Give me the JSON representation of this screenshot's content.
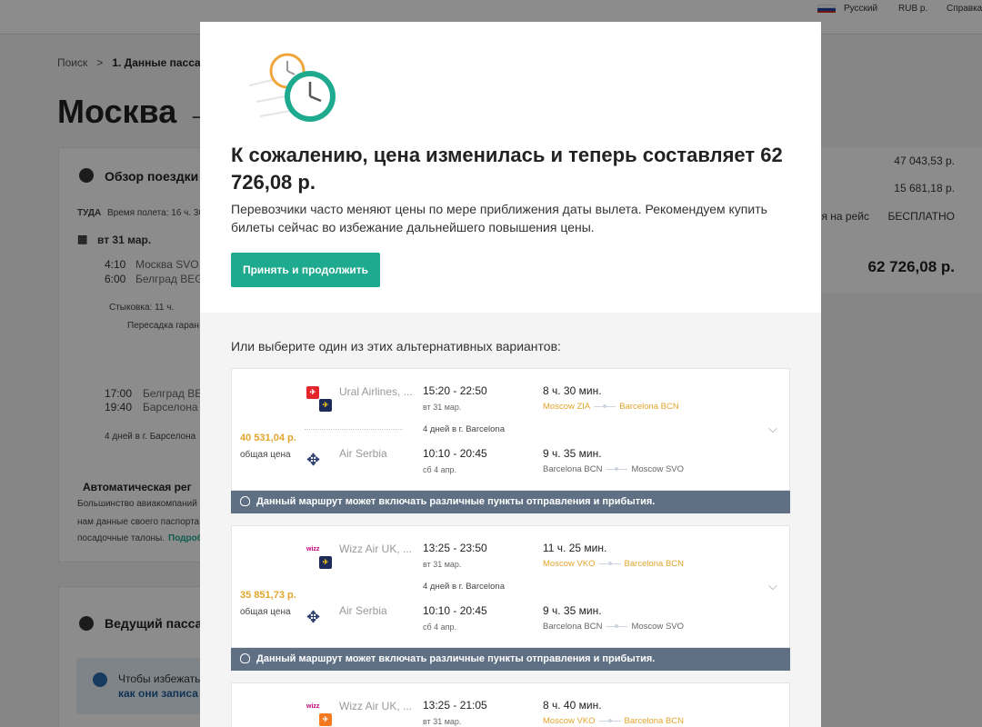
{
  "topbar": {
    "language": "Русский",
    "currency": "RUB р.",
    "help": "Справка",
    "flag_colors": [
      "#ffffff",
      "#1c48a8",
      "#d52b1e"
    ]
  },
  "background": {
    "breadcrumb": {
      "search": "Поиск",
      "separator": ">",
      "step": "1. Данные пасса"
    },
    "title": "Москва →",
    "trip": {
      "heading": "Обзор поездки",
      "direction": "ТУДА",
      "flight_time": "Время полета: 16 ч. 30",
      "date": "вт 31 мар.",
      "seg1_dep_time": "4:10",
      "seg1_dep": "Москва SVO",
      "seg1_arr_time": "6:00",
      "seg1_arr": "Белград BEG",
      "layover": "Стыковка: 11 ч.",
      "transfer": "Пересадка гаран",
      "seg2_dep_time": "17:00",
      "seg2_dep": "Белград BEG",
      "seg2_arr_time": "19:40",
      "seg2_arr": "Барселона B",
      "stay": "4 дней в г. Барселона"
    },
    "auto_reg": {
      "heading": "Автоматическая рег",
      "line1": "Большинство авиакомпаний",
      "line2": "нам данные своего паспорта",
      "line3": "посадочные талоны.",
      "link": "Подроб"
    },
    "passenger": {
      "heading": "Ведущий пассаж",
      "info1": "Чтобы избежать",
      "info2": "как они записа"
    },
    "prices": {
      "p1": "47 043,53 р.",
      "p2": "15 681,18 р.",
      "checkin_label": "я на рейс",
      "checkin_value": "БЕСПЛАТНО",
      "total": "62 726,08 р."
    }
  },
  "modal": {
    "heading": "К сожалению, цена изменилась и теперь составляет 62 726,08 р.",
    "text": "Перевозчики часто меняют цены по мере приближения даты вылета. Рекомендуем купить билеты сейчас во избежание дальнейшего повышения цены.",
    "accept_button": "Принять и продолжить",
    "alternatives_heading": "Или выберите один из этих альтернативных вариантов:",
    "accent_color": "#1eaa8e",
    "price_color": "#e3a52c",
    "banner_text": "Данный маршрут может включать различные пункты отправления и прибытия.",
    "options": [
      {
        "price": "40 531,04 р.",
        "price_label": "общая цена",
        "out_airline": "Ural Airlines, ...",
        "out_time": "15:20 - 22:50",
        "out_date": "вт 31 мар.",
        "out_duration": "8 ч. 30 мин.",
        "out_from": "Moscow ZIA",
        "out_to": "Barcelona BCN",
        "stay": "4 дней в г. Barcelona",
        "ret_airline": "Air Serbia",
        "ret_time": "10:10 - 20:45",
        "ret_date": "сб 4 апр.",
        "ret_duration": "9 ч. 35 мин.",
        "ret_from": "Barcelona BCN",
        "ret_to": "Moscow SVO"
      },
      {
        "price": "35 851,73 р.",
        "price_label": "общая цена",
        "out_airline": "Wizz Air UK, ...",
        "out_time": "13:25 - 23:50",
        "out_date": "вт 31 мар.",
        "out_duration": "11 ч. 25 мин.",
        "out_from": "Moscow VKO",
        "out_to": "Barcelona BCN",
        "stay": "4 дней в г. Barcelona",
        "ret_airline": "Air Serbia",
        "ret_time": "10:10 - 20:45",
        "ret_date": "сб 4 апр.",
        "ret_duration": "9 ч. 35 мин.",
        "ret_from": "Barcelona BCN",
        "ret_to": "Moscow SVO"
      },
      {
        "out_airline": "Wizz Air UK, ...",
        "out_time": "13:25 - 21:05",
        "out_date": "вт 31 мар.",
        "out_duration": "8 ч. 40 мин.",
        "out_from": "Moscow VKO",
        "out_to": "Barcelona BCN"
      }
    ]
  }
}
